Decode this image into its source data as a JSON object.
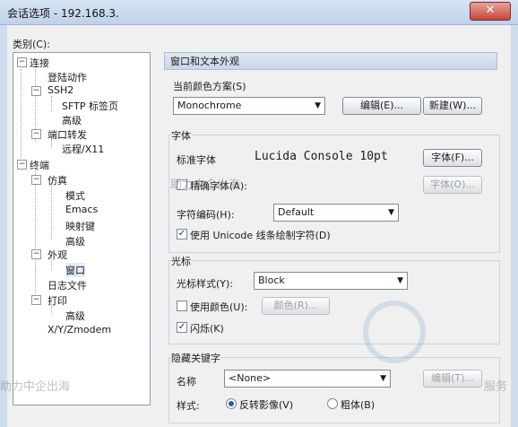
{
  "window": {
    "title": "会话选项 - 192.168.3.",
    "close_glyph": "✕"
  },
  "sidebar": {
    "label": "类别(C):",
    "tree": {
      "connection": "连接",
      "login_actions": "登陆动作",
      "ssh2": "SSH2",
      "sftp_tab": "SFTP 标签页",
      "advanced1": "高级",
      "port_forward": "端口转发",
      "remote_x11": "远程/X11",
      "terminal": "终端",
      "emulation": "仿真",
      "modes": "模式",
      "emacs": "Emacs",
      "mapped_keys": "映射键",
      "advanced2": "高级",
      "appearance": "外观",
      "window": "窗口",
      "log_file": "日志文件",
      "print": "打印",
      "advanced3": "高级",
      "xyz": "X/Y/Zmodem"
    }
  },
  "panel": {
    "header": "窗口和文本外观",
    "scheme": {
      "label": "当前颜色方案(S)",
      "value": "Monochrome",
      "edit": "编辑(E)...",
      "new": "新建(W)..."
    },
    "font": {
      "group": "字体",
      "standard_label": "标准字体",
      "standard_value": "Lucida Console 10pt",
      "font_button": "字体(F)...",
      "precise_label": "精确字体(A):",
      "precise_button": "字体(O)...",
      "encoding_label": "字符编码(H):",
      "encoding_value": "Default",
      "unicode_label": "使用 Unicode 线条绘制字符(D)"
    },
    "cursor": {
      "group": "光标",
      "style_label": "光标样式(Y):",
      "style_value": "Block",
      "use_color": "使用颜色(U):",
      "color_button": "颜色(R)...",
      "blink": "闪烁(K)"
    },
    "hotkey": {
      "group": "隐藏关键字",
      "name_label": "名称",
      "name_value": "<None>",
      "edit_button": "编辑(T)...",
      "style_label": "样式:",
      "reverse": "反转影像(V)",
      "bold": "粗体(B)"
    }
  },
  "watermarks": {
    "line1": "助力中企出海",
    "line2": "服务",
    "brand": "助力中企出海"
  },
  "colors": {
    "accent": "#2c5da0",
    "titlebar": "#c6d7ec",
    "close": "#c5463a"
  }
}
